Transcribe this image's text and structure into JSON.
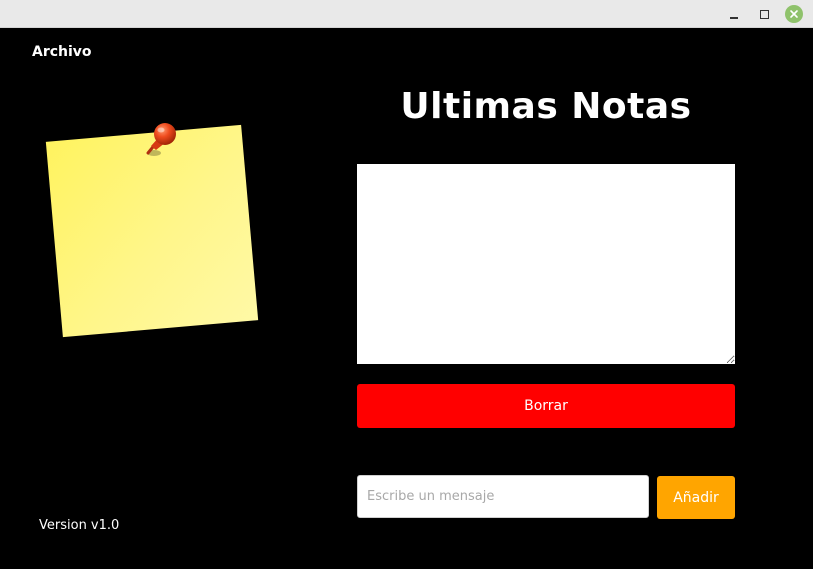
{
  "window": {
    "controls": {
      "minimize_icon": "minimize-icon",
      "maximize_icon": "maximize-icon",
      "close_icon": "close-icon"
    },
    "colors": {
      "background": "#000000",
      "titlebar": "#e9e9e9",
      "close_button": "#8fc26b"
    }
  },
  "menu": {
    "archivo_label": "Archivo"
  },
  "illustration": {
    "note_icon": "sticky-note-icon",
    "pin_icon": "pushpin-icon",
    "note_color": "#fff35f",
    "pin_color": "#e0401a"
  },
  "main": {
    "title": "Ultimas Notas",
    "notes_value": "",
    "delete_button_label": "Borrar",
    "delete_button_color": "#ff0000",
    "message_input": {
      "value": "",
      "placeholder": "Escribe un mensaje"
    },
    "add_button_label": "Añadir",
    "add_button_color": "#ffa500"
  },
  "footer": {
    "version": "Version v1.0"
  }
}
